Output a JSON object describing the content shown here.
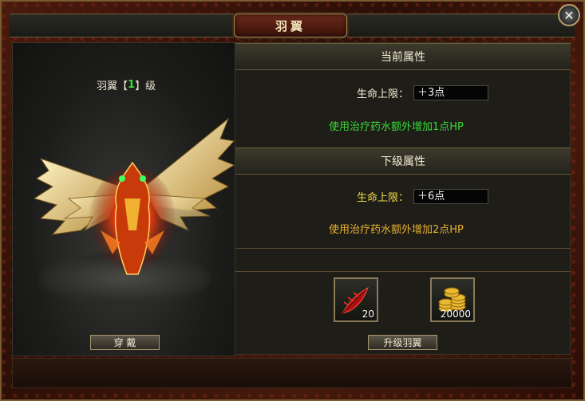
{
  "window": {
    "title": "羽翼",
    "close_icon": "close-icon"
  },
  "left": {
    "level_prefix": "羽翼【",
    "level_value": "1",
    "level_suffix": "】级",
    "equip_label": "穿 戴"
  },
  "current": {
    "header": "当前属性",
    "hp_label": "生命上限：",
    "hp_value": "＋3点",
    "note": "使用治疗药水额外增加1点HP",
    "note_color": "#3ad83a"
  },
  "next": {
    "header": "下级属性",
    "hp_label": "生命上限：",
    "hp_value": "＋6点",
    "note": "使用治疗药水额外增加2点HP",
    "note_color": "#e8b030",
    "label_color": "#f0d848"
  },
  "materials": [
    {
      "icon": "red-feather-icon",
      "count": "20"
    },
    {
      "icon": "gold-coins-icon",
      "count": "20000"
    }
  ],
  "upgrade_label": "升级羽翼"
}
